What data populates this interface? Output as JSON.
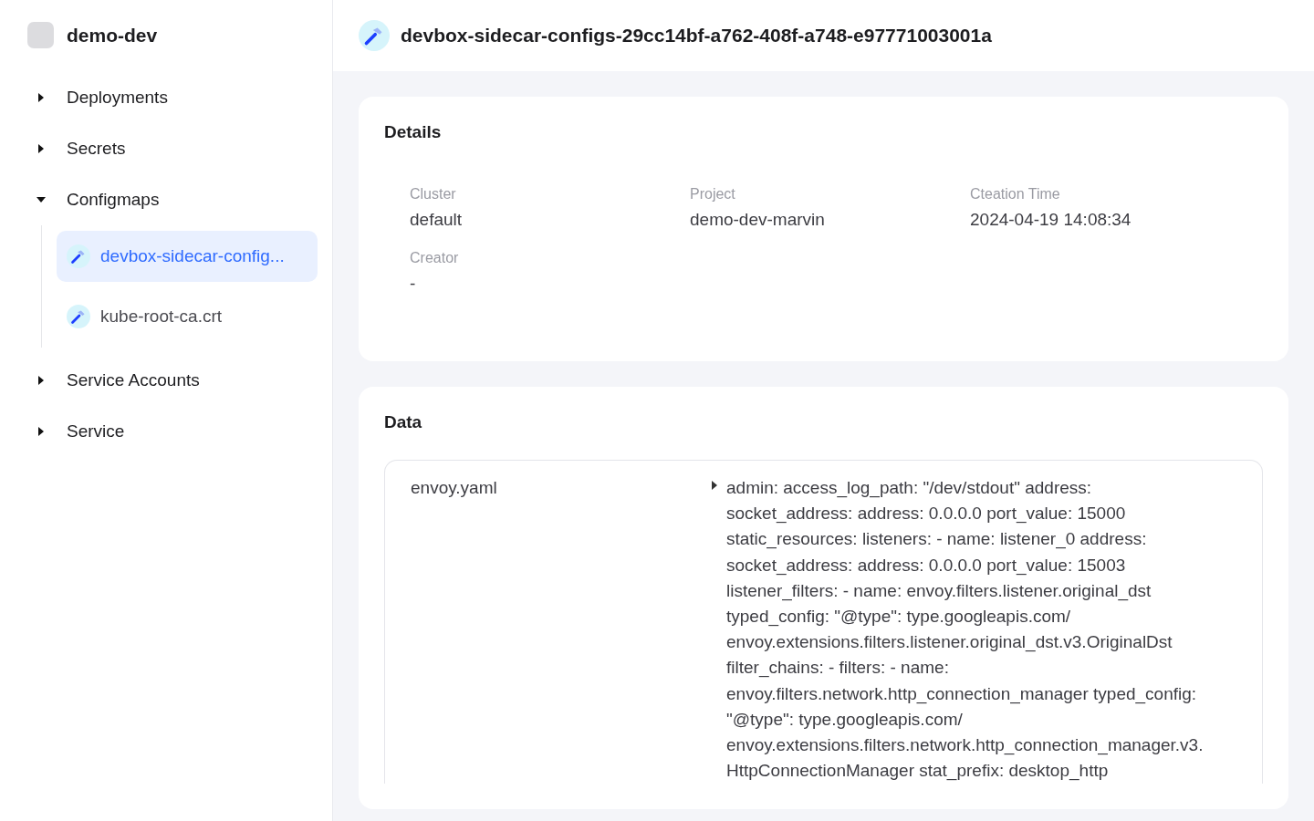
{
  "workspace": {
    "name": "demo-dev"
  },
  "sidebar": {
    "items": [
      {
        "label": "Deployments",
        "expanded": false
      },
      {
        "label": "Secrets",
        "expanded": false
      },
      {
        "label": "Configmaps",
        "expanded": true,
        "children": [
          {
            "label": "devbox-sidecar-config...",
            "selected": true
          },
          {
            "label": "kube-root-ca.crt",
            "selected": false
          }
        ]
      },
      {
        "label": "Service Accounts",
        "expanded": false
      },
      {
        "label": "Service",
        "expanded": false
      }
    ]
  },
  "header": {
    "title": "devbox-sidecar-configs-29cc14bf-a762-408f-a748-e97771003001a"
  },
  "details": {
    "title": "Details",
    "fields": [
      {
        "label": "Cluster",
        "value": "default"
      },
      {
        "label": "Project",
        "value": "demo-dev-marvin"
      },
      {
        "label": "Cteation Time",
        "value": "2024-04-19 14:08:34"
      },
      {
        "label": "Creator",
        "value": "-"
      }
    ]
  },
  "data": {
    "title": "Data",
    "entries": [
      {
        "key": "envoy.yaml",
        "expanded": false,
        "value_lines": [
          "admin: access_log_path: \"/dev/stdout\" address:",
          "socket_address: address: 0.0.0.0 port_value: 15000",
          "static_resources: listeners: - name: listener_0 address:",
          "socket_address: address: 0.0.0.0 port_value: 15003",
          "listener_filters: - name: envoy.filters.listener.original_dst",
          "typed_config: \"@type\": type.googleapis.com/",
          "envoy.extensions.filters.listener.original_dst.v3.OriginalDst",
          "filter_chains: - filters: - name:",
          "envoy.filters.network.http_connection_manager typed_config:",
          "\"@type\": type.googleapis.com/",
          "envoy.extensions.filters.network.http_connection_manager.v3.",
          "HttpConnectionManager stat_prefix: desktop_http"
        ]
      }
    ]
  }
}
